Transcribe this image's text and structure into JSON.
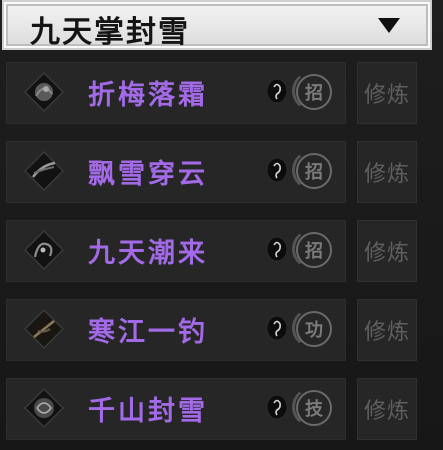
{
  "header": {
    "title": "九天掌封雪"
  },
  "skills": [
    {
      "name": "折梅落霜",
      "type_char": "招",
      "train_label": "修炼"
    },
    {
      "name": "飘雪穿云",
      "type_char": "招",
      "train_label": "修炼"
    },
    {
      "name": "九天潮来",
      "type_char": "招",
      "train_label": "修炼"
    },
    {
      "name": "寒江一钓",
      "type_char": "功",
      "train_label": "修炼"
    },
    {
      "name": "千山封雪",
      "type_char": "技",
      "train_label": "修炼"
    }
  ],
  "icons": {
    "skill": "skill-ink-diamond-icon",
    "seed": "seed-drop-icon",
    "dropdown": "triangle-down-icon"
  },
  "colors": {
    "skill_name": "#a26ae6",
    "disabled_text": "#5f5f5f",
    "panel_bg": "#262626"
  }
}
